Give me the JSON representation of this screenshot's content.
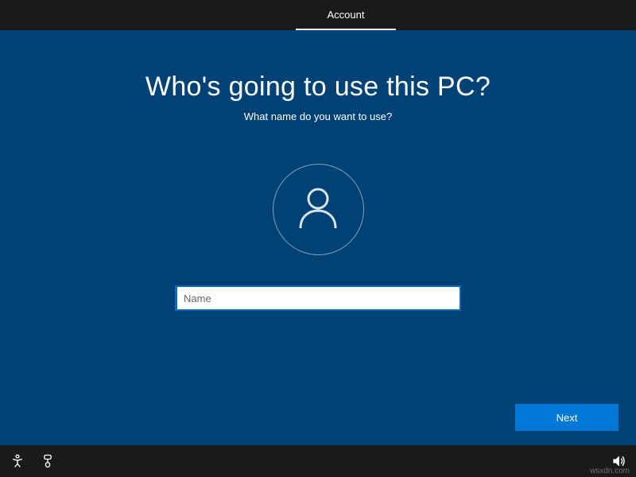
{
  "header": {
    "tab_label": "Account"
  },
  "main": {
    "heading": "Who's going to use this PC?",
    "subheading": "What name do you want to use?",
    "name_placeholder": "Name",
    "name_value": "",
    "next_label": "Next"
  },
  "icons": {
    "user": "user-icon",
    "ease_of_access": "ease-of-access-icon",
    "input_method": "input-method-icon",
    "volume": "volume-icon"
  },
  "watermark": "wsxdn.com"
}
